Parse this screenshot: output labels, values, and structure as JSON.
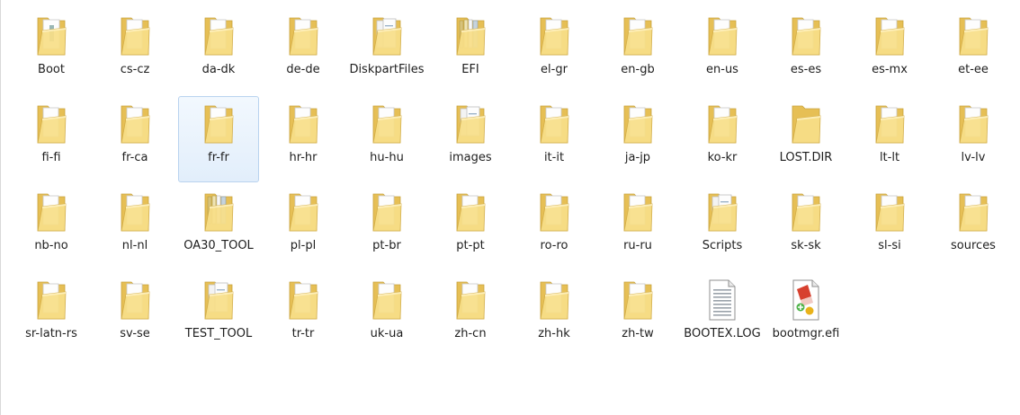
{
  "items": [
    {
      "label": "Boot",
      "icon": "folder-icon",
      "type": "folder",
      "content": "tool"
    },
    {
      "label": "cs-cz",
      "icon": "folder-icon",
      "type": "folder",
      "content": "doc"
    },
    {
      "label": "da-dk",
      "icon": "folder-icon",
      "type": "folder",
      "content": "doc"
    },
    {
      "label": "de-de",
      "icon": "folder-icon",
      "type": "folder",
      "content": "doc"
    },
    {
      "label": "DiskpartFiles",
      "icon": "folder-icon",
      "type": "folder",
      "content": "docs"
    },
    {
      "label": "EFI",
      "icon": "folder-icon",
      "type": "folder",
      "content": "stack"
    },
    {
      "label": "el-gr",
      "icon": "folder-icon",
      "type": "folder",
      "content": "doc"
    },
    {
      "label": "en-gb",
      "icon": "folder-icon",
      "type": "folder",
      "content": "doc"
    },
    {
      "label": "en-us",
      "icon": "folder-icon",
      "type": "folder",
      "content": "doc"
    },
    {
      "label": "es-es",
      "icon": "folder-icon",
      "type": "folder",
      "content": "doc"
    },
    {
      "label": "es-mx",
      "icon": "folder-icon",
      "type": "folder",
      "content": "doc"
    },
    {
      "label": "et-ee",
      "icon": "folder-icon",
      "type": "folder",
      "content": "doc"
    },
    {
      "label": "fi-fi",
      "icon": "folder-icon",
      "type": "folder",
      "content": "doc"
    },
    {
      "label": "fr-ca",
      "icon": "folder-icon",
      "type": "folder",
      "content": "doc"
    },
    {
      "label": "fr-fr",
      "icon": "folder-icon",
      "type": "folder",
      "content": "doc",
      "selected": true
    },
    {
      "label": "hr-hr",
      "icon": "folder-icon",
      "type": "folder",
      "content": "doc"
    },
    {
      "label": "hu-hu",
      "icon": "folder-icon",
      "type": "folder",
      "content": "doc"
    },
    {
      "label": "images",
      "icon": "folder-icon",
      "type": "folder",
      "content": "docs"
    },
    {
      "label": "it-it",
      "icon": "folder-icon",
      "type": "folder",
      "content": "doc"
    },
    {
      "label": "ja-jp",
      "icon": "folder-icon",
      "type": "folder",
      "content": "doc"
    },
    {
      "label": "ko-kr",
      "icon": "folder-icon",
      "type": "folder",
      "content": "doc"
    },
    {
      "label": "LOST.DIR",
      "icon": "folder-icon",
      "type": "folder",
      "content": "empty"
    },
    {
      "label": "lt-lt",
      "icon": "folder-icon",
      "type": "folder",
      "content": "doc"
    },
    {
      "label": "lv-lv",
      "icon": "folder-icon",
      "type": "folder",
      "content": "doc"
    },
    {
      "label": "nb-no",
      "icon": "folder-icon",
      "type": "folder",
      "content": "doc"
    },
    {
      "label": "nl-nl",
      "icon": "folder-icon",
      "type": "folder",
      "content": "doc"
    },
    {
      "label": "OA30_TOOL",
      "icon": "folder-icon",
      "type": "folder",
      "content": "stack"
    },
    {
      "label": "pl-pl",
      "icon": "folder-icon",
      "type": "folder",
      "content": "doc"
    },
    {
      "label": "pt-br",
      "icon": "folder-icon",
      "type": "folder",
      "content": "doc"
    },
    {
      "label": "pt-pt",
      "icon": "folder-icon",
      "type": "folder",
      "content": "doc"
    },
    {
      "label": "ro-ro",
      "icon": "folder-icon",
      "type": "folder",
      "content": "doc"
    },
    {
      "label": "ru-ru",
      "icon": "folder-icon",
      "type": "folder",
      "content": "doc"
    },
    {
      "label": "Scripts",
      "icon": "folder-icon",
      "type": "folder",
      "content": "docs"
    },
    {
      "label": "sk-sk",
      "icon": "folder-icon",
      "type": "folder",
      "content": "doc"
    },
    {
      "label": "sl-si",
      "icon": "folder-icon",
      "type": "folder",
      "content": "doc"
    },
    {
      "label": "sources",
      "icon": "folder-icon",
      "type": "folder",
      "content": "doc"
    },
    {
      "label": "sr-latn-rs",
      "icon": "folder-icon",
      "type": "folder",
      "content": "doc"
    },
    {
      "label": "sv-se",
      "icon": "folder-icon",
      "type": "folder",
      "content": "doc"
    },
    {
      "label": "TEST_TOOL",
      "icon": "folder-icon",
      "type": "folder",
      "content": "docs"
    },
    {
      "label": "tr-tr",
      "icon": "folder-icon",
      "type": "folder",
      "content": "doc"
    },
    {
      "label": "uk-ua",
      "icon": "folder-icon",
      "type": "folder",
      "content": "doc"
    },
    {
      "label": "zh-cn",
      "icon": "folder-icon",
      "type": "folder",
      "content": "doc"
    },
    {
      "label": "zh-hk",
      "icon": "folder-icon",
      "type": "folder",
      "content": "doc"
    },
    {
      "label": "zh-tw",
      "icon": "folder-icon",
      "type": "folder",
      "content": "doc"
    },
    {
      "label": "BOOTEX.LOG",
      "icon": "text-file-icon",
      "type": "textfile"
    },
    {
      "label": "bootmgr.efi",
      "icon": "efi-file-icon",
      "type": "efifile"
    }
  ],
  "colors": {
    "folder_back": "#e8c25a",
    "folder_front": "#f7dd86",
    "selection_border": "#b9d3ef"
  }
}
